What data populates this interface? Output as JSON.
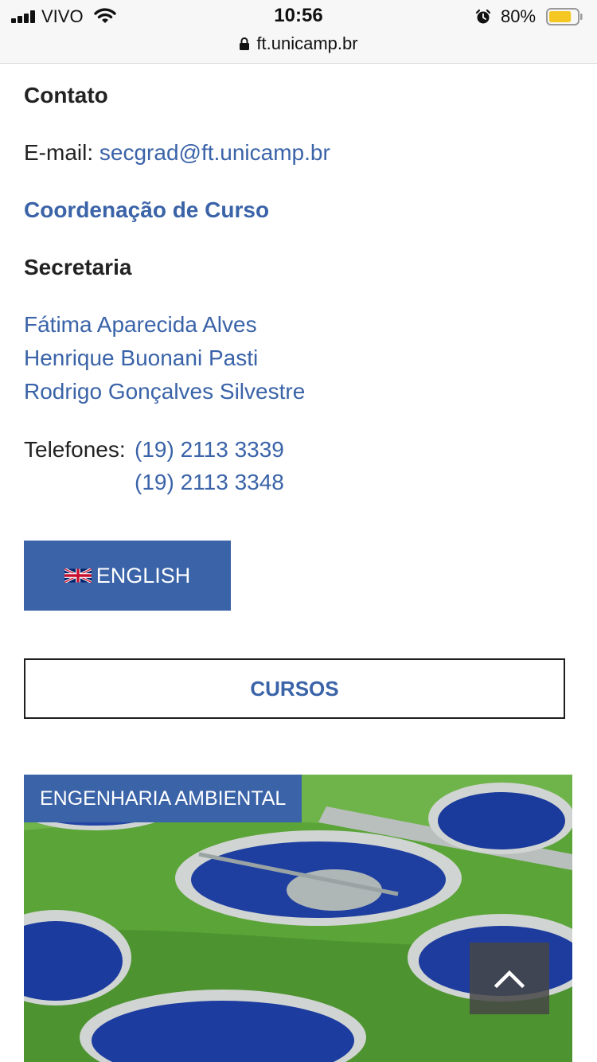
{
  "status": {
    "carrier": "VIVO",
    "time": "10:56",
    "battery": "80%",
    "battery_level": 0.8
  },
  "browser": {
    "url": "ft.unicamp.br"
  },
  "contact": {
    "heading": "Contato",
    "email_label": "E-mail:",
    "email": "secgrad@ft.unicamp.br",
    "coordination_link": "Coordenação de Curso",
    "secretary_heading": "Secretaria",
    "staff": [
      "Fátima Aparecida Alves",
      "Henrique Buonani Pasti",
      "Rodrigo Gonçalves Silvestre"
    ],
    "phones_label": "Telefones:",
    "phones": [
      "(19) 2113 3339",
      "(19) 2113 3348"
    ]
  },
  "buttons": {
    "english": "ENGLISH",
    "courses": "CURSOS"
  },
  "course_card": {
    "label": "ENGENHARIA AMBIENTAL"
  },
  "icons": {
    "lock": "lock-icon",
    "flag": "uk-flag-icon",
    "back_to_top": "chevron-up-icon"
  },
  "colors": {
    "accent": "#3a63a8",
    "text": "#222222"
  }
}
